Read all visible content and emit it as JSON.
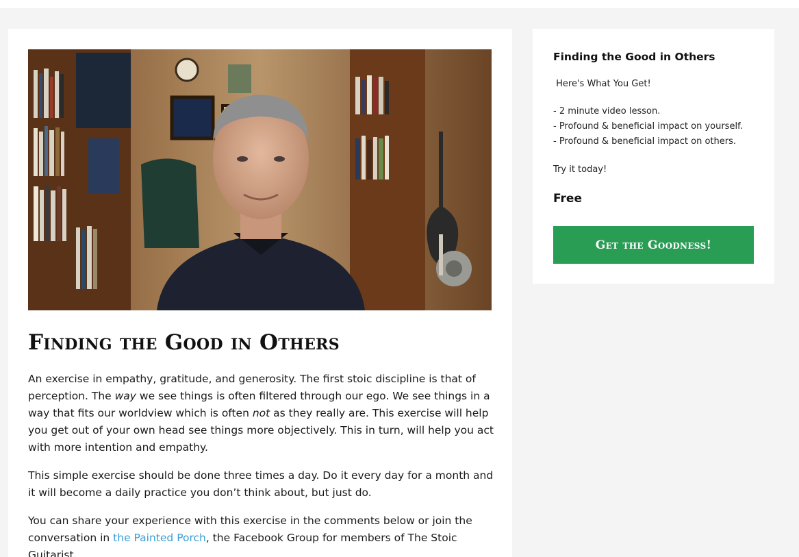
{
  "main": {
    "image_alt": "Man smiling in a room with bookshelves and guitars",
    "title": "Finding the Good in Others",
    "p1": {
      "s1": " An exercise in empathy, gratitude, and generosity. The first stoic discipline is that of perception. The ",
      "em1": "way",
      "s2": " we see things is often filtered through our ego. We see things in a way that fits our worldview which is often ",
      "em2": "not",
      "s3": " as they really are. This exercise will help you get out of your own head see things more objectively. This in turn, will help you act with more intention and empathy."
    },
    "p2": "This simple exercise should be done three times a day. Do it every day for a month and it will become a daily practice you don’t think about, but just do.",
    "p3": {
      "before": "You can share your experience with this exercise in the comments below or join the conversation in ",
      "link": "the Painted Porch",
      "after": ", the Facebook Group for members of The Stoic Guitarist."
    }
  },
  "sidebar": {
    "title": "Finding the Good in Others",
    "intro": " Here's What You Get!",
    "items": [
      "- 2 minute video lesson.",
      "- Profound & beneficial impact on yourself.",
      "- Profound & beneficial impact on others."
    ],
    "try": "Try it today!",
    "price": "Free",
    "cta": "Get the Goodness!"
  },
  "colors": {
    "background": "#f4f4f4",
    "card": "#ffffff",
    "link": "#3b9dd6",
    "cta": "#2a9d55"
  }
}
